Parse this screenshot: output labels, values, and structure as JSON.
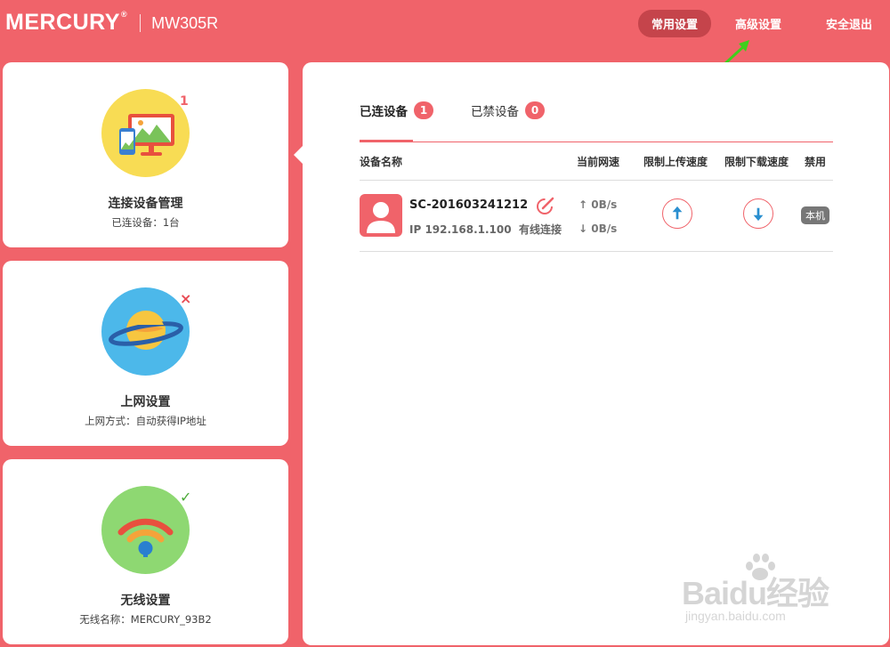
{
  "header": {
    "logo": "MERCURY",
    "model": "MW305R",
    "nav": [
      {
        "label": "常用设置",
        "active": true
      },
      {
        "label": "高级设置",
        "active": false
      },
      {
        "label": "安全退出",
        "active": false
      }
    ]
  },
  "sidebar": {
    "cards": [
      {
        "title": "连接设备管理",
        "subtitle": "已连设备：1台",
        "badge": "1",
        "badge_color": "#f0636a",
        "circle_color": "#f8dc54",
        "icon": "monitor-phone-icon"
      },
      {
        "title": "上网设置",
        "subtitle": "上网方式：自动获得IP地址",
        "badge": "×",
        "badge_color": "#e84c55",
        "circle_color": "#4cb8ea",
        "icon": "planet-icon"
      },
      {
        "title": "无线设置",
        "subtitle": "无线名称：MERCURY_93B2",
        "badge": "✓",
        "badge_color": "#4caa3a",
        "circle_color": "#8ed872",
        "icon": "wifi-icon"
      }
    ]
  },
  "main": {
    "tabs": [
      {
        "label": "已连设备",
        "count": "1",
        "active": true
      },
      {
        "label": "已禁设备",
        "count": "0",
        "active": false
      }
    ],
    "columns": [
      "设备名称",
      "当前网速",
      "限制上传速度",
      "限制下载速度",
      "禁用"
    ],
    "devices": [
      {
        "name": "SC-201603241212",
        "ip": "IP 192.168.1.100",
        "connection": "有线连接",
        "upload_speed": "0B/s",
        "download_speed": "0B/s",
        "tag": "本机"
      }
    ]
  },
  "colors": {
    "accent": "#f0636a",
    "nav_active": "#c5444b",
    "upload_arrow": "#2a8fd0",
    "download_arrow": "#2a8fd0"
  },
  "watermark": {
    "logo": "Baidu经验",
    "url": "jingyan.baidu.com"
  }
}
